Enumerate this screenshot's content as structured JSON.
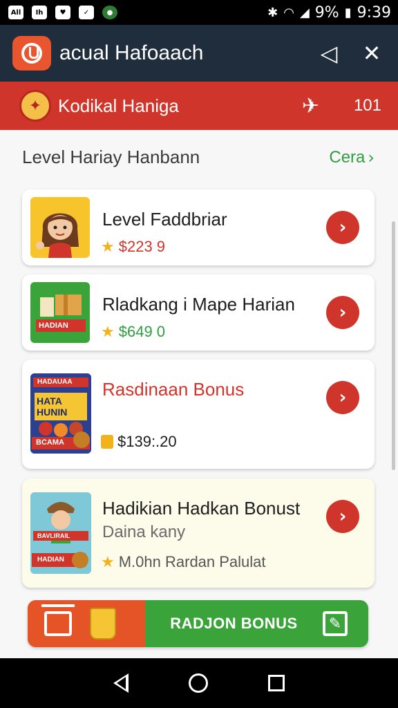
{
  "status_bar": {
    "left_icons": [
      {
        "text": "All",
        "icon": "all-notification-icon"
      },
      {
        "text": "Ih",
        "icon": "chart-notification-icon"
      },
      {
        "text": "♥",
        "icon": "heart-notification-icon"
      },
      {
        "text": "✓",
        "icon": "check-notification-icon"
      },
      {
        "text": "●",
        "icon": "app-notification-icon"
      }
    ],
    "battery": "9%",
    "time": "9:39"
  },
  "app_bar": {
    "title": "acual Hafoaach",
    "actions": [
      {
        "icon": "share-icon",
        "glyph": "◁"
      },
      {
        "icon": "close-icon",
        "glyph": "✕"
      }
    ]
  },
  "banner": {
    "title": "Kodikal Haniga",
    "count": "101",
    "plane_glyph": "✈"
  },
  "section": {
    "title": "Level Hariay Hanbann",
    "link": "Cera"
  },
  "cards": [
    {
      "title": "Level Faddbriar",
      "meta": "$223 9",
      "meta_icon": "star-icon",
      "meta_color": "#d0352b"
    },
    {
      "title": "Rladkang i Mape Harian",
      "meta": "$649 0",
      "meta_icon": "star-icon",
      "meta_color": "#2e9e3e",
      "thumb_label": "HADIAN"
    },
    {
      "title": "Rasdinaan Bonus",
      "meta": "$139:.20",
      "meta_icon": "gift-icon",
      "meta_color": "#1d1d1d",
      "thumb_top": "HADAUAA",
      "thumb_mid": "HATA HUNIN",
      "thumb_bottom": "BCAMA"
    },
    {
      "title": "Hadikian Hadkan Bonust",
      "subtitle": "Daina kany",
      "meta": "M.0hn Rardan Palulat",
      "meta_icon": "star-icon",
      "meta_color": "#555555",
      "thumb_label_1": "BAVLIRAIL",
      "thumb_label_2": "HADIAN"
    }
  ],
  "bonus_button": {
    "label": "RADJON BONUS"
  },
  "colors": {
    "primary_red": "#d0352b",
    "app_bar": "#1f2d3d",
    "accent_green": "#3aa43a",
    "accent_orange": "#e55427"
  }
}
